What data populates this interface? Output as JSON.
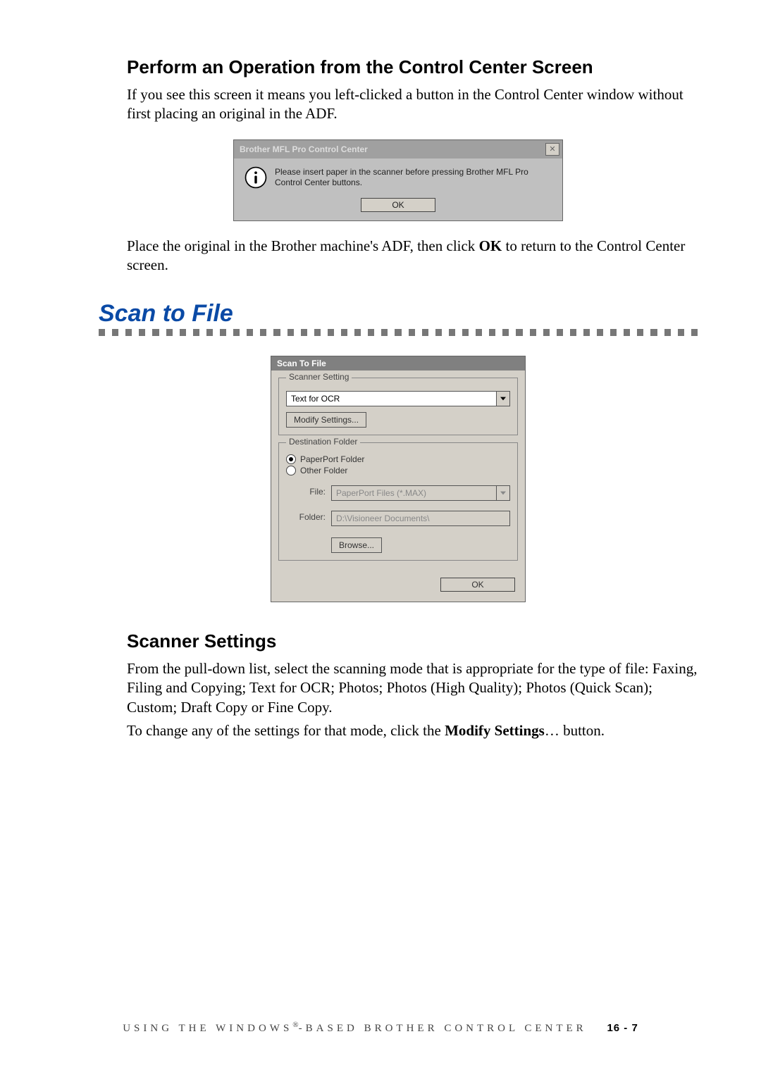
{
  "heading_perform": "Perform an Operation from the Control Center Screen",
  "para_perform_1": "If you see this screen it means you left-clicked a button in the Control Center window without first placing an original in the ADF.",
  "dialog1": {
    "title": "Brother MFL Pro Control Center",
    "message": "Please insert paper in the scanner before pressing Brother MFL Pro Control Center buttons.",
    "ok": "OK"
  },
  "para_perform_2a": "Place the original in the Brother machine's ADF, then click ",
  "para_perform_2b": "OK",
  "para_perform_2c": " to return to the Control Center screen.",
  "scan_to_file_title": "Scan to File",
  "dialog2": {
    "title": "Scan To File",
    "scanner_setting_legend": "Scanner Setting",
    "scanner_mode": "Text for OCR",
    "modify_settings": "Modify Settings...",
    "dest_folder_legend": "Destination Folder",
    "radio_paperport": "PaperPort Folder",
    "radio_other": "Other Folder",
    "file_label": "File:",
    "file_value": "PaperPort Files (*.MAX)",
    "folder_label": "Folder:",
    "folder_value": "D:\\Visioneer Documents\\",
    "browse": "Browse...",
    "ok": "OK"
  },
  "heading_scanner_settings": "Scanner Settings",
  "para_ss_1": "From the pull-down list, select the scanning mode that is appropriate for the type of file:  Faxing, Filing and Copying; Text for OCR; Photos; Photos (High Quality); Photos (Quick Scan); Custom; Draft Copy or Fine Copy.",
  "para_ss_2a": "To change any of the settings for that mode, click the ",
  "para_ss_2b": "Modify Settings",
  "para_ss_2c": "… button.",
  "footer": {
    "text_a": "USING THE WINDOWS",
    "reg": "®",
    "text_b": "-BASED BROTHER CONTROL CENTER",
    "page": "16 - 7"
  }
}
